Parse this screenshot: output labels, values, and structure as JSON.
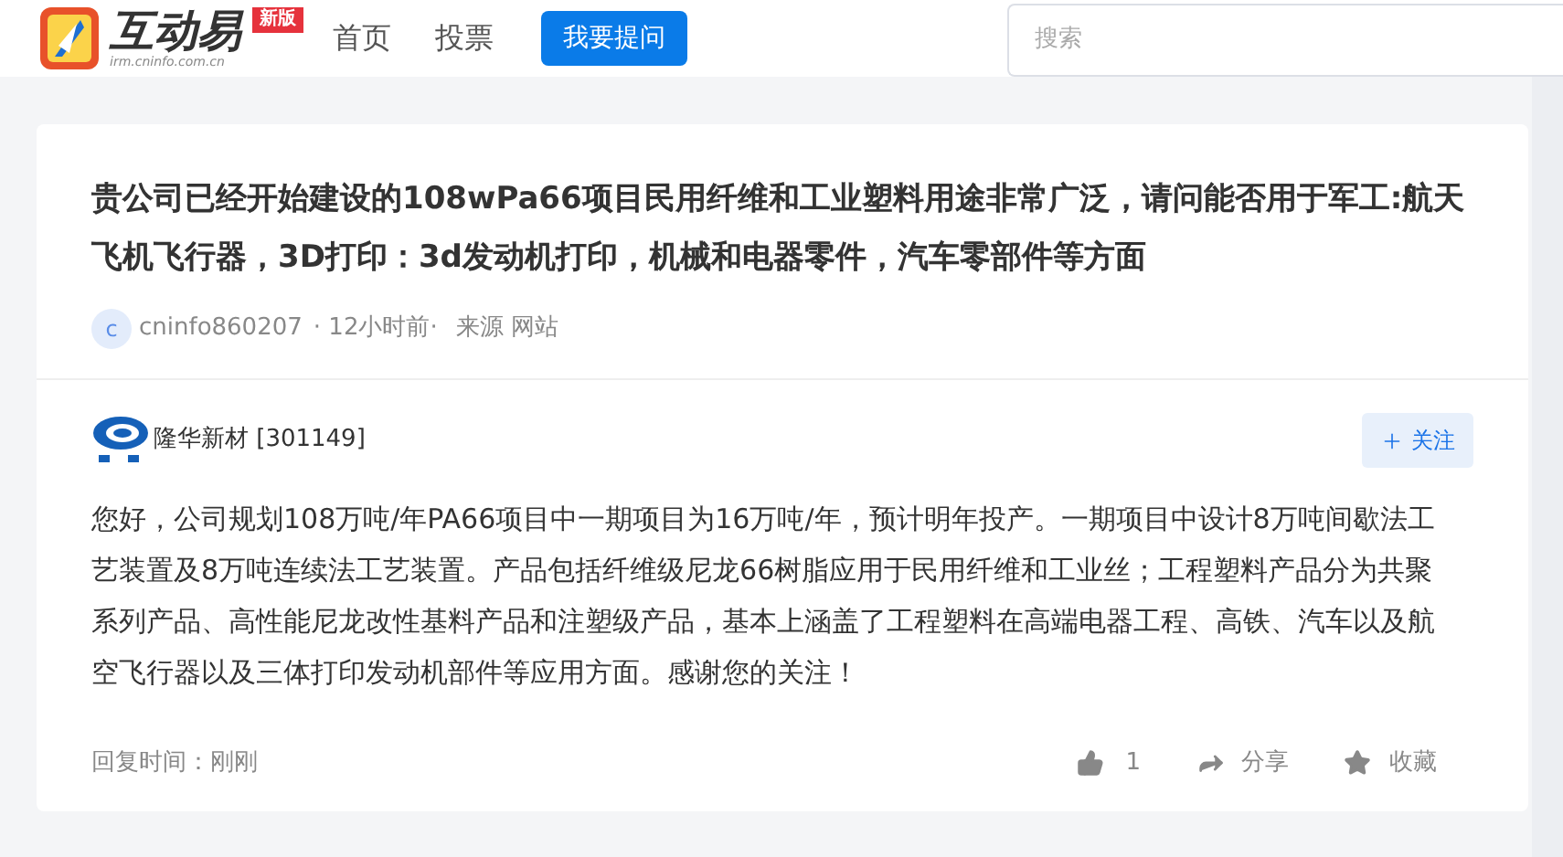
{
  "header": {
    "logo_title": "互动易",
    "logo_badge": "新版",
    "logo_url": "irm.cninfo.com.cn",
    "nav": [
      {
        "label": "首页",
        "selected": false
      },
      {
        "label": "投票",
        "selected": false
      }
    ],
    "ask_button": "我要提问",
    "search": {
      "placeholder": "搜索"
    }
  },
  "question": {
    "title": "贵公司已经开始建设的108wPa66项目民用纤维和工业塑料用途非常广泛，请问能否用于军工:航天飞机飞行器，3D打印：3d发动机打印，机械和电器零件，汽车零部件等方面",
    "avatar_letter": "c",
    "user": "cninfo860207",
    "time": "· 12小时前·",
    "source": "来源 网站"
  },
  "answer": {
    "company": "隆华新材 [301149]",
    "follow_button": "关注",
    "text": "您好，公司规划108万吨/年PA66项目中一期项目为16万吨/年，预计明年投产。一期项目中设计8万吨间歇法工艺装置及8万吨连续法工艺装置。产品包括纤维级尼龙66树脂应用于民用纤维和工业丝；工程塑料产品分为共聚系列产品、高性能尼龙改性基料产品和注塑级产品，基本上涵盖了工程塑料在高端电器工程、高铁、汽车以及航空飞行器以及三体打印发动机部件等应用方面。感谢您的关注！",
    "reply_time": "回复时间：刚刚",
    "likes": "1",
    "share": "分享",
    "favorite": "收藏"
  }
}
